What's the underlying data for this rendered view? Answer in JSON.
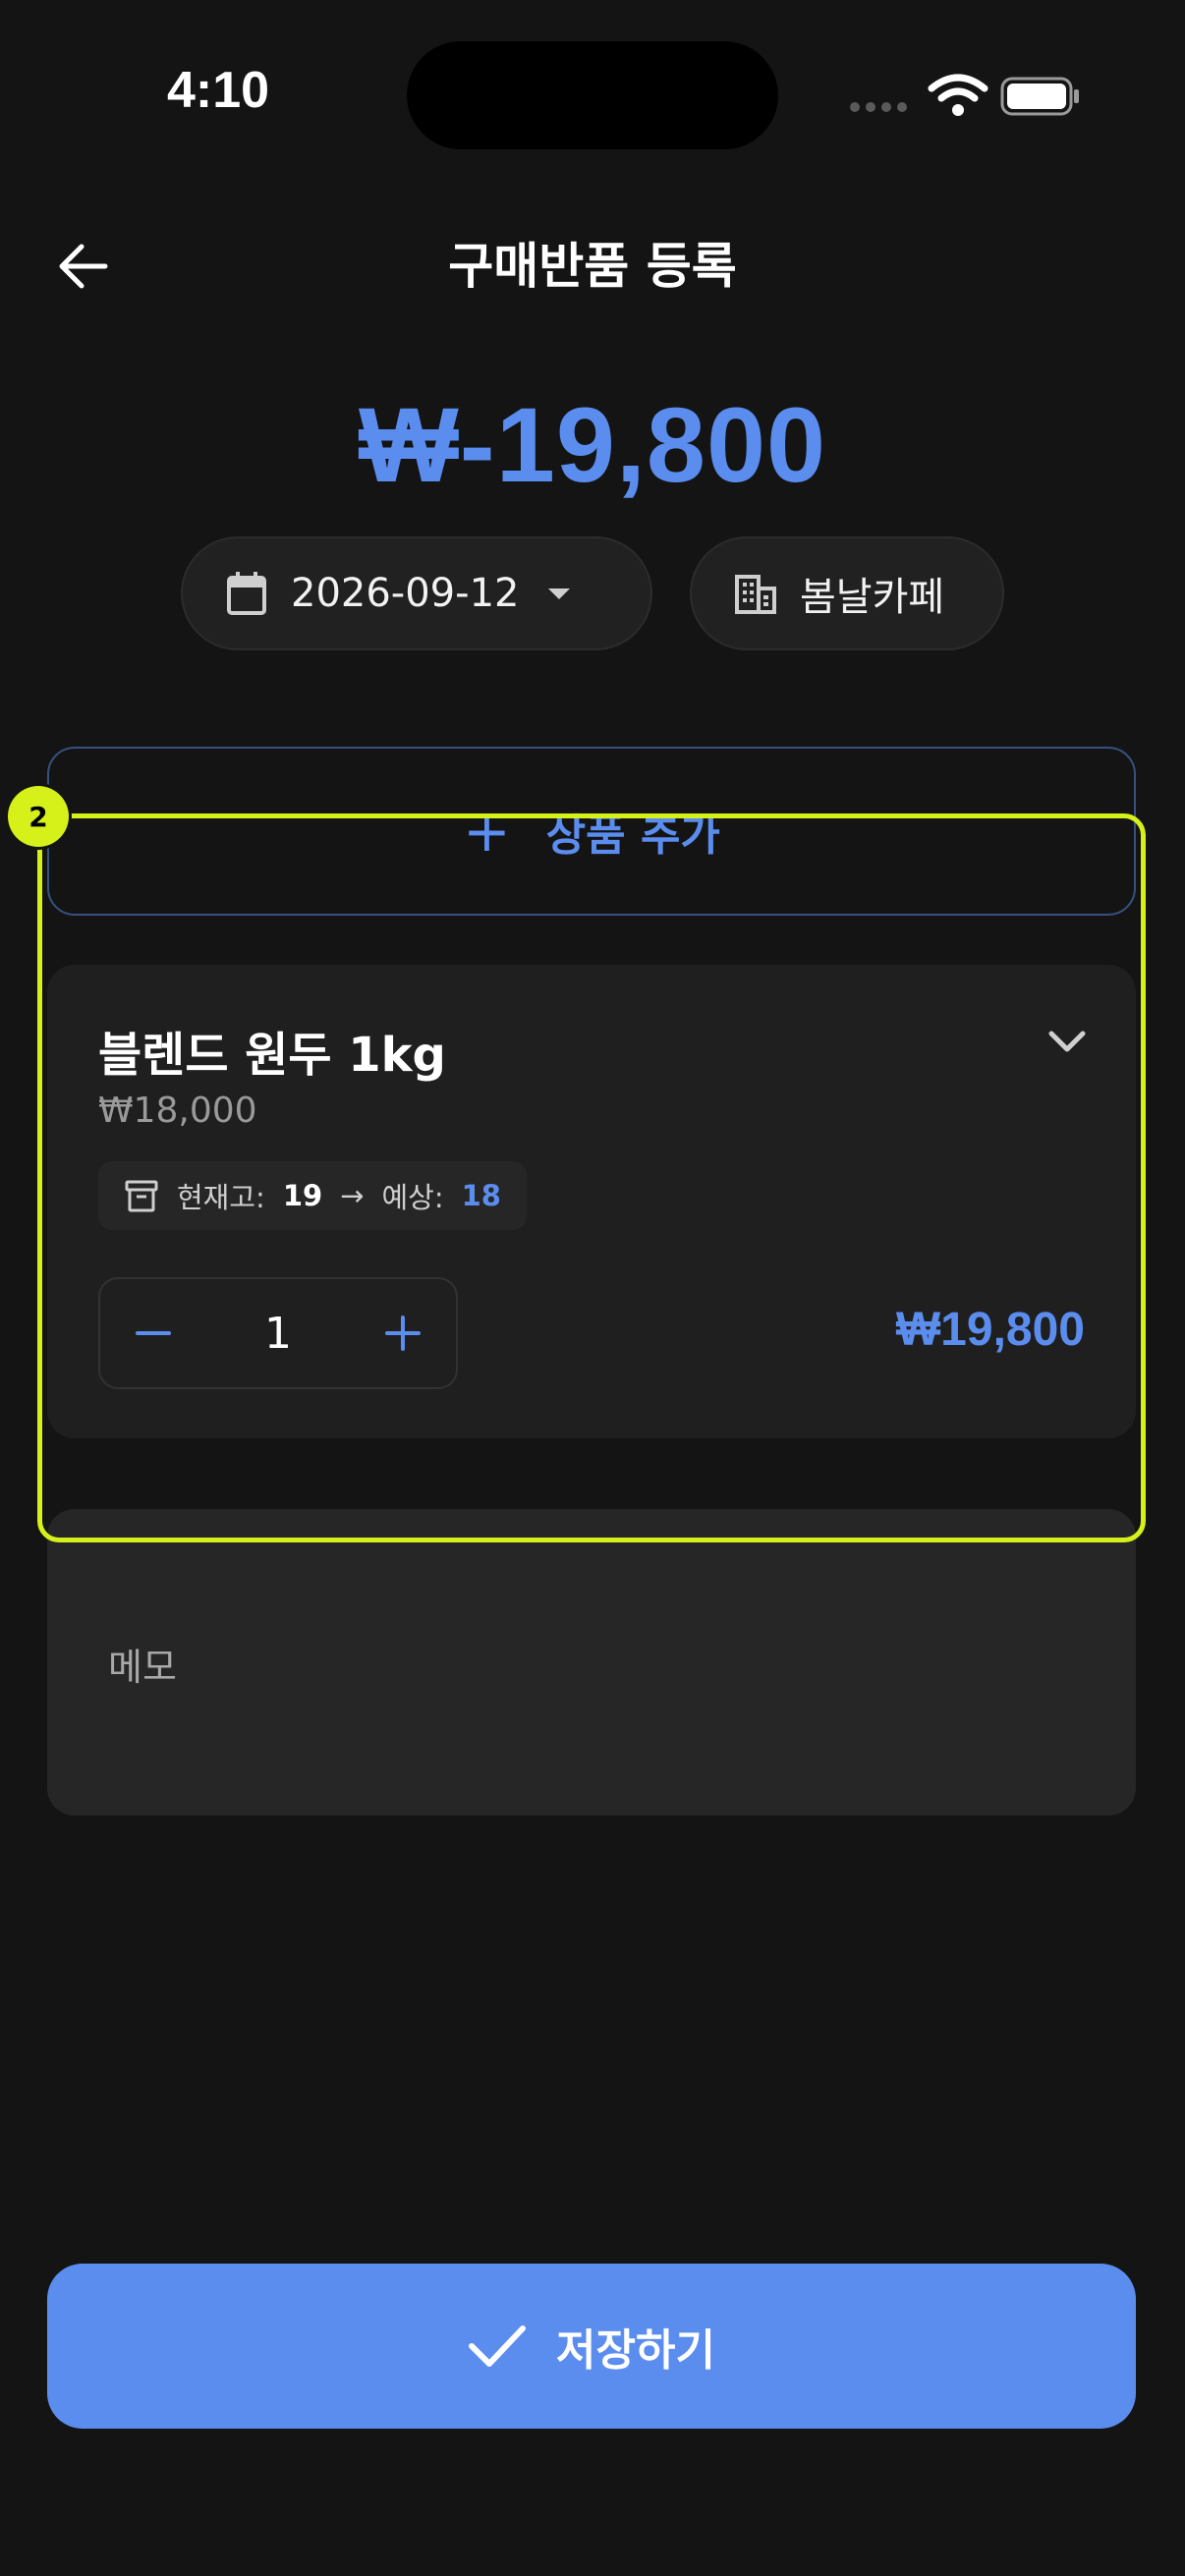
{
  "status_bar": {
    "time": "4:10"
  },
  "header": {
    "title": "구매반품 등록",
    "back_icon": "arrow-left-icon"
  },
  "summary": {
    "total_amount": "₩-19,800"
  },
  "filters": {
    "date": {
      "value": "2026-09-12",
      "icon": "calendar-icon"
    },
    "store": {
      "value": "봄날카페",
      "icon": "building-icon"
    }
  },
  "add_product": {
    "label": "상품 추가",
    "icon": "plus-icon"
  },
  "item": {
    "name": "블렌드 원두 1kg",
    "unit_price": "₩18,000",
    "stock_label": "현재고:",
    "stock_current": "19",
    "stock_arrow": "→",
    "expected_label": "예상:",
    "stock_expected": "18",
    "quantity": "1",
    "line_total": "₩19,800"
  },
  "memo": {
    "placeholder": "메모"
  },
  "annotation": {
    "badge": "2"
  },
  "footer": {
    "save_label": "저장하기"
  },
  "colors": {
    "accent": "#5b8def",
    "background": "#141414",
    "card": "#1f1f1f",
    "annotation": "#d6f01a"
  }
}
